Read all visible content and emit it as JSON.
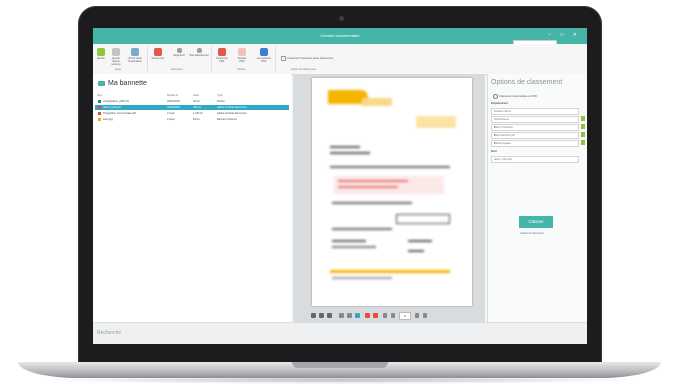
{
  "window": {
    "title": "Gestion documentaire",
    "controls": [
      "−",
      "□",
      "✕"
    ]
  },
  "ribbon": {
    "buttons": [
      {
        "label": "Ajouter",
        "icon": "add-icon"
      },
      {
        "label": "Ajouter depuis scanner",
        "icon": "scanner-icon"
      },
      {
        "label": "Ouvrir dans l'explorateur",
        "icon": "folder-icon"
      },
      {
        "label": "Renommer",
        "icon": "rename-icon"
      },
      {
        "label": "Supprimer",
        "icon": "delete-icon"
      },
      {
        "label": "Tout sélectionner",
        "icon": "select-all-icon"
      },
      {
        "label": "Fusionner PDF",
        "icon": "merge-icon"
      },
      {
        "label": "Scinder PDF",
        "icon": "split-icon"
      },
      {
        "label": "Compresser PDF",
        "icon": "compress-icon"
      }
    ],
    "group_labels": [
      "Ajout",
      "Document",
      "Actions",
      "Option de classement"
    ],
    "option_checkbox": "Conserver l'historique après classement"
  },
  "left_pane": {
    "title": "Ma bannette",
    "columns": [
      "Nom",
      "Modifié le",
      "Taille",
      "Type"
    ],
    "rows": [
      {
        "name": "configuration_2015.xls",
        "date": "30/07/2015",
        "size": "32 Ko",
        "type": "Fichier",
        "icon_color": "#2e8b57",
        "selected": false
      },
      {
        "name": "devis_frutiq.pdf",
        "date": "30/10/2015",
        "size": "255 Ko",
        "type": "Adobe Acrobat Document",
        "icon_color": "#e74c3c",
        "selected": true
      },
      {
        "name": "Proposition commerciale.pdf",
        "date": "2 mois",
        "size": "1 243 Ko",
        "type": "Adobe Acrobat Document",
        "icon_color": "#e74c3c",
        "selected": false
      },
      {
        "name": "scan.jpg",
        "date": "2 jours",
        "size": "84 Ko",
        "type": "Élément Scanner",
        "icon_color": "#f0b400",
        "selected": false
      }
    ]
  },
  "viewer": {
    "page_input": "1"
  },
  "search": {
    "placeholder": "Recherche"
  },
  "right_pane": {
    "title": "Options de classement",
    "option_text": "Classement automatique du PDF",
    "section_label": "Emplacement",
    "fields": [
      {
        "value": "Dossier clients",
        "dropdown": false
      },
      {
        "value": "Fournisseurs",
        "dropdown": false
      },
      {
        "value": "Devis / Factures",
        "dropdown": true
      },
      {
        "value": "Devis factures pdf",
        "dropdown": true
      },
      {
        "value": "Pièces légales",
        "dropdown": true
      }
    ],
    "name_label": "Nom",
    "name_value": "devis_frutiq.pdf",
    "classer_label": "Classer",
    "link_label": "Classer le document"
  },
  "colors": {
    "accent": "#45b5a8",
    "selection": "#2da8c8",
    "check": "#8cc63f"
  }
}
